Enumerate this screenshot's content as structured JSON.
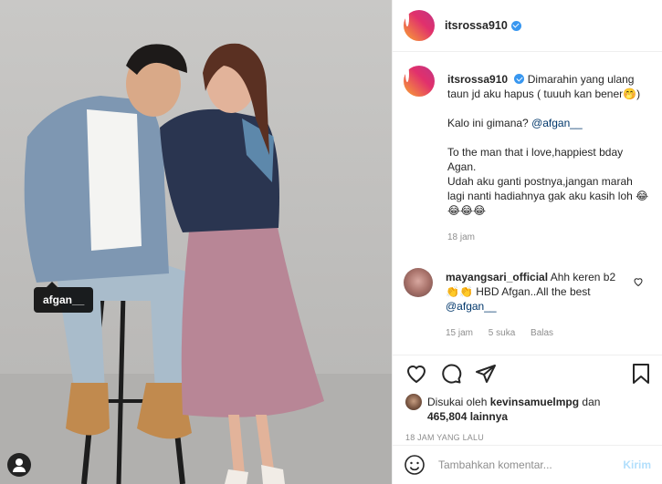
{
  "post": {
    "username": "itsrossa910",
    "photo_tag": "afgan__"
  },
  "caption": {
    "username": "itsrossa910",
    "line1": "Dimarahin yang ulang taun jd aku hapus ( tuuuh kan bener🤭)",
    "line2_prefix": "Kalo ini gimana? ",
    "line2_mention": "@afgan__",
    "line3": "To the man that i love,happiest bday Agan.",
    "line4": "Udah aku ganti postnya,jangan marah lagi nanti hadiahnya gak aku kasih loh 😂😂😂😂",
    "time": "18 jam"
  },
  "comment": {
    "username": "mayangsari_official",
    "text": "Ahh keren b2 👏👏 HBD Afgan..All the best",
    "mention": "@afgan__",
    "time": "15 jam",
    "likes": "5 suka",
    "reply": "Balas"
  },
  "likes": {
    "prefix": "Disukai oleh ",
    "user": "kevinsamuelmpg",
    "middle": " dan",
    "count": "465,804 lainnya"
  },
  "timestamp": "18 JAM YANG LALU",
  "add_comment": {
    "placeholder": "Tambahkan komentar...",
    "send": "Kirim"
  }
}
